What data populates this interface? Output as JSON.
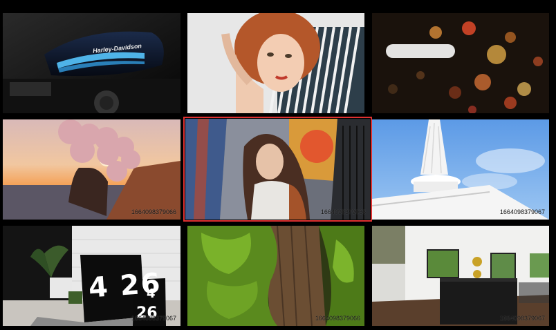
{
  "gallery": {
    "selected_index": 4,
    "tiles": [
      {
        "subject": "motorcycle-fuel-tank",
        "brand_text": "Harley-Davidson",
        "id_text": ""
      },
      {
        "subject": "woman-portrait-striped-shirt",
        "id_text": ""
      },
      {
        "subject": "city-bokeh-lights",
        "id_text": ""
      },
      {
        "subject": "woman-with-balloons-sunset",
        "id_text": "1664098379066"
      },
      {
        "subject": "woman-graffiti-wall",
        "id_text": "1664098379066"
      },
      {
        "subject": "white-tower-blue-sky",
        "id_text": "1664098379067"
      },
      {
        "subject": "laptop-clock-desk",
        "clock_text": "4 26",
        "small_clock_top": "4",
        "small_clock_bottom": "26",
        "id_text": "1664098379067"
      },
      {
        "subject": "mossy-tree-trunk",
        "id_text": "1664098379066"
      },
      {
        "subject": "modern-kitchen-interior",
        "id_text": "1664098379067"
      }
    ],
    "colors": {
      "background": "#000000",
      "selection_border": "#e03131"
    }
  }
}
